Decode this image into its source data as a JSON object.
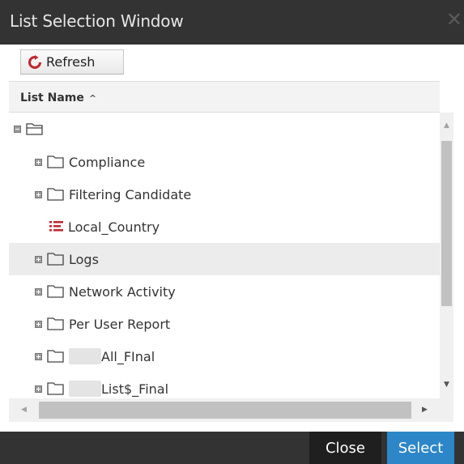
{
  "window": {
    "title": "List Selection Window"
  },
  "toolbar": {
    "refresh_label": "Refresh"
  },
  "table": {
    "column_header": "List Name",
    "sort_indicator": "^"
  },
  "tree": {
    "rows": [
      {
        "label": "",
        "type": "root-folder",
        "expander": "minus"
      },
      {
        "label": "Compliance",
        "type": "folder",
        "expander": "plus"
      },
      {
        "label": "Filtering Candidate",
        "type": "folder",
        "expander": "plus"
      },
      {
        "label": "Local_Country",
        "type": "list",
        "expander": "none"
      },
      {
        "label": "Logs",
        "type": "folder",
        "expander": "plus",
        "selected": true
      },
      {
        "label": "Network Activity",
        "type": "folder",
        "expander": "plus"
      },
      {
        "label": "Per User Report",
        "type": "folder",
        "expander": "plus"
      },
      {
        "label": "All_FInal",
        "type": "folder",
        "expander": "plus",
        "redacted_prefix": true
      },
      {
        "label": "List$_Final",
        "type": "folder",
        "expander": "plus",
        "redacted_prefix": true
      }
    ]
  },
  "footer": {
    "close_label": "Close",
    "select_label": "Select"
  },
  "colors": {
    "titlebar": "#333333",
    "accent": "#2d86c7",
    "refresh_icon": "#c0262d",
    "list_icon": "#c0262d"
  },
  "icons": {
    "close": "close-icon",
    "refresh": "refresh-icon",
    "folder": "folder-icon",
    "open_folder": "folder-open-icon",
    "list": "list-icon"
  }
}
